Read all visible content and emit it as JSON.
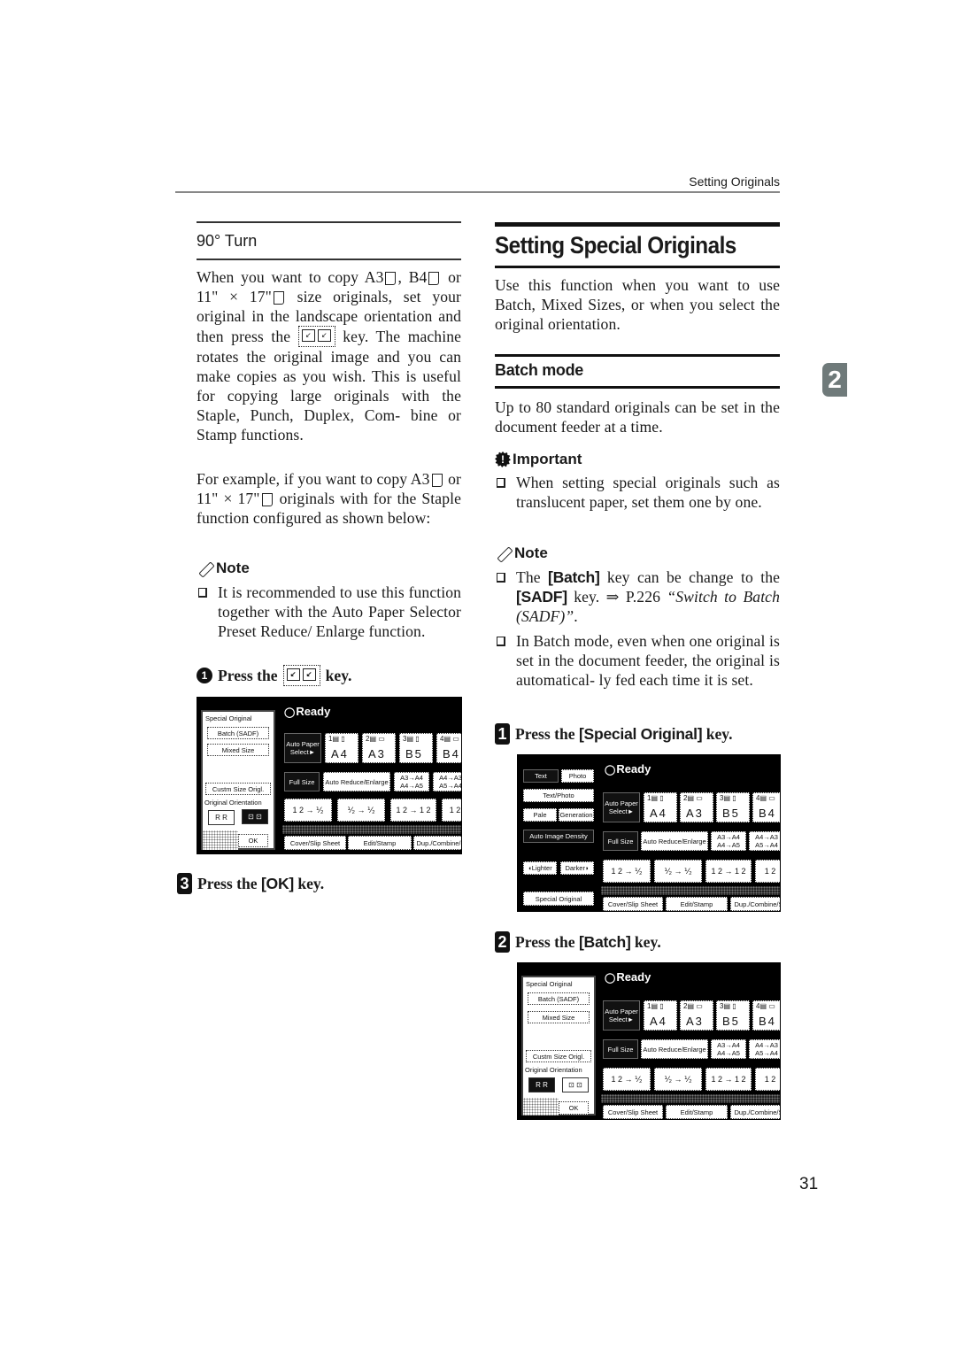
{
  "header": {
    "section_title": "Setting Originals"
  },
  "chapter_tab": "2",
  "page_number": "31",
  "left_column": {
    "subheading": "90° Turn",
    "para1_parts": {
      "a": "When you want to copy A3",
      "b": ",",
      "c": "B4",
      "d": " or 11\" × 17\"",
      "e": " size originals, set your original in the landscape orientation and then press the",
      "f": " key. The machine rotates the original image and you can make copies as you wish. This is useful for copying large originals with the Staple, Punch, Duplex, Com- bine or Stamp functions."
    },
    "para2_parts": {
      "a": "For example, if you want to copy A3",
      "b": " or 11\" × 17\"",
      "c": " originals with for the Staple function configured as shown below:"
    },
    "note_heading": "Note",
    "note_items": [
      "It is recommended to use this function together with the Auto Paper Selector Preset Reduce/ Enlarge function."
    ],
    "step1": {
      "number": "1",
      "prefix": "Press the",
      "suffix": "key."
    },
    "step3": {
      "number": "3",
      "prefix": "Press the ",
      "key": "[OK]",
      "suffix": " key."
    }
  },
  "right_column": {
    "title": "Setting Special Originals",
    "intro": "Use this function when you want to use Batch, Mixed Sizes, or when you select the original orientation.",
    "section_heading": "Batch mode",
    "section_text": "Up to 80 standard originals can be set in the document feeder at a time.",
    "important_heading": "Important",
    "important_items": [
      "When setting special originals such as translucent paper, set them one by one."
    ],
    "note_heading": "Note",
    "note1": {
      "a": "The ",
      "k1": "[Batch]",
      "b": " key can be change to the ",
      "k2": "[SADF]",
      "c": " key. ⇒ P.226 ",
      "ref": "“Switch to Batch (SADF)”",
      "d": "."
    },
    "note2": "In Batch mode, even when one original is set in the document feeder, the original is automatical- ly fed each time it is set.",
    "step1": {
      "number": "1",
      "prefix": "Press the ",
      "key": "[Special Original]",
      "suffix": " key."
    },
    "step2": {
      "number": "2",
      "prefix": "Press the ",
      "key": "[Batch]",
      "suffix": " key."
    }
  },
  "screens": {
    "ready": "Ready",
    "auto_paper": "Auto Paper Select►",
    "paper_trays": [
      {
        "tray": "1▤ ▯",
        "size": "A4"
      },
      {
        "tray": "2▤ ▭",
        "size": "A3"
      },
      {
        "tray": "3▤ ▯",
        "size": "B5"
      },
      {
        "tray": "4▤ ▭",
        "size": "B4"
      }
    ],
    "full_size": "Full Size",
    "auto_reduce": "Auto Reduce/Enlarge",
    "preset1": "A3→A4 A4→A5",
    "preset2": "A4→A3 A5→A4",
    "dup_tiles": [
      "1 2 → ⅟₂",
      "⅟₂ → ⅟₂",
      "1 2 → 1 2",
      "1 2"
    ],
    "bottom_tabs": [
      "Cover/Slip Sheet",
      "Edit/Stamp",
      "Dup./Combine/S"
    ],
    "special_panel": {
      "title": "Special Original",
      "batch": "Batch (SADF)",
      "mixed": "Mixed Size",
      "custom": "Custm Size Origl.",
      "orientation_label": "Original Orientation",
      "orient_a": "R R",
      "orient_b": "⊡ ⊡",
      "ok": "OK"
    },
    "main_panel": {
      "text": "Text",
      "photo": "Photo",
      "text_photo": "Text/Photo",
      "pale": "Pale",
      "generation": "Generation",
      "auto_density": "Auto Image Density",
      "lighter": "◖Lighter",
      "darker": "Darker◗",
      "special_original": "Special Original"
    }
  }
}
